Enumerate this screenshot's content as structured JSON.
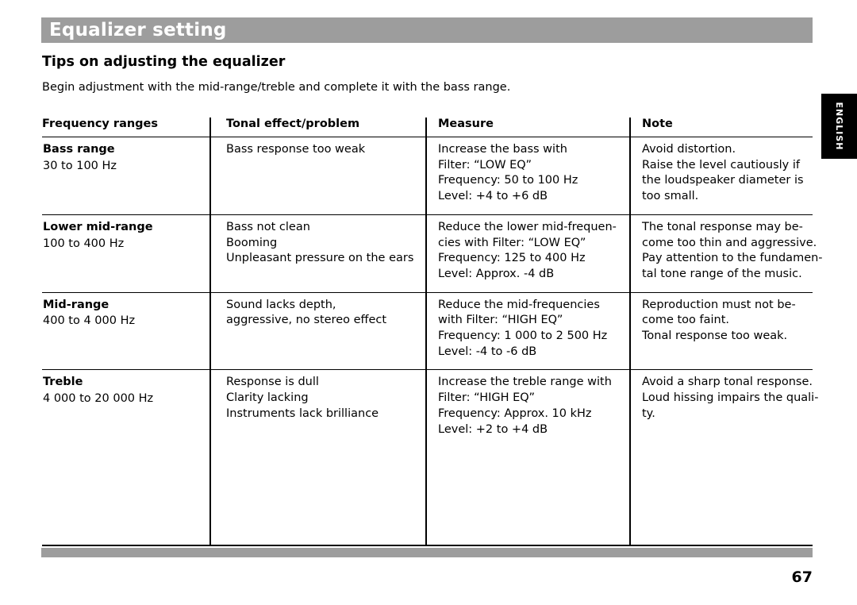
{
  "header": {
    "title": "Equalizer setting"
  },
  "subtitle": "Tips on adjusting the equalizer",
  "intro": "Begin adjustment with the mid-range/treble and complete it with the bass range.",
  "side_tab": {
    "label": "ENGLISH"
  },
  "table": {
    "headers": {
      "col1": "Frequency ranges",
      "col2": "Tonal effect/problem",
      "col3": "Measure",
      "col4": "Note"
    },
    "rows": [
      {
        "range_name": "Bass range",
        "range_hz": "30 to 100 Hz",
        "effect": [
          "Bass response too weak"
        ],
        "measure": [
          "Increase the bass with",
          "Filter: “LOW EQ”",
          "Frequency: 50 to 100 Hz",
          "Level: +4 to +6 dB"
        ],
        "note": [
          "Avoid distortion.",
          "Raise the level cautiously if",
          "the loudspeaker diameter is",
          "too small."
        ]
      },
      {
        "range_name": "Lower mid-range",
        "range_hz": "100 to 400 Hz",
        "effect": [
          "Bass not clean",
          "Booming",
          "Unpleasant pressure on the ears"
        ],
        "measure": [
          "Reduce the lower mid-frequen-",
          "cies with Filter: “LOW EQ”",
          "Frequency: 125 to 400 Hz",
          "Level: Approx. -4 dB"
        ],
        "note": [
          "The tonal response may be-",
          "come too thin and aggressive.",
          "Pay attention to the fundamen-",
          "tal tone range of the music."
        ]
      },
      {
        "range_name": "Mid-range",
        "range_hz": "400 to 4 000 Hz",
        "effect": [
          "Sound lacks depth,",
          "aggressive, no stereo effect"
        ],
        "measure": [
          "Reduce the mid-frequencies",
          "with Filter: “HIGH EQ”",
          "Frequency: 1 000 to  2 500 Hz",
          "Level: -4 to -6 dB"
        ],
        "note": [
          "Reproduction must not be-",
          "come too faint.",
          "Tonal response too weak."
        ]
      },
      {
        "range_name": "Treble",
        "range_hz": "4 000 to 20 000 Hz",
        "effect": [
          "Response is dull",
          "Clarity lacking",
          "Instruments lack brilliance"
        ],
        "measure": [
          "Increase the treble range with",
          "Filter: “HIGH EQ”",
          "Frequency: Approx. 10 kHz",
          "Level: +2 to +4 dB"
        ],
        "note": [
          "Avoid a sharp tonal response.",
          "Loud hissing impairs the quali-",
          "ty."
        ]
      }
    ]
  },
  "page_number": "67"
}
